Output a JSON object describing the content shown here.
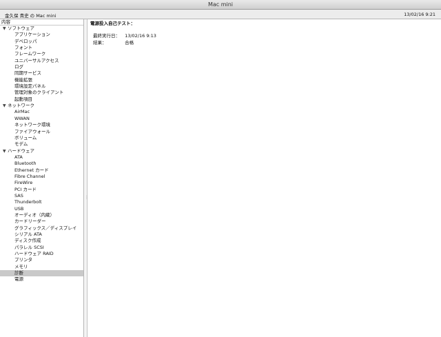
{
  "window": {
    "title": "Mac mini"
  },
  "header": {
    "machine": "金久保 貴史 の Mac mini",
    "date": "13/02/16 9:21"
  },
  "sidebar": {
    "header": "内容",
    "tree": [
      {
        "type": "cat",
        "label": "ソフトウェア"
      },
      {
        "type": "item",
        "label": "アプリケーション"
      },
      {
        "type": "item",
        "label": "デベロッパ"
      },
      {
        "type": "item",
        "label": "フォント"
      },
      {
        "type": "item",
        "label": "フレームワーク"
      },
      {
        "type": "item",
        "label": "ユニバーサルアクセス"
      },
      {
        "type": "item",
        "label": "ログ"
      },
      {
        "type": "item",
        "label": "同期サービス"
      },
      {
        "type": "item",
        "label": "機能拡張"
      },
      {
        "type": "item",
        "label": "環境設定パネル"
      },
      {
        "type": "item",
        "label": "管理対象のクライアント"
      },
      {
        "type": "item",
        "label": "起動項目"
      },
      {
        "type": "cat",
        "label": "ネットワーク"
      },
      {
        "type": "item",
        "label": "AirMac"
      },
      {
        "type": "item",
        "label": "WWAN"
      },
      {
        "type": "item",
        "label": "ネットワーク環境"
      },
      {
        "type": "item",
        "label": "ファイアウォール"
      },
      {
        "type": "item",
        "label": "ボリューム"
      },
      {
        "type": "item",
        "label": "モデム"
      },
      {
        "type": "cat",
        "label": "ハードウェア"
      },
      {
        "type": "item",
        "label": "ATA"
      },
      {
        "type": "item",
        "label": "Bluetooth"
      },
      {
        "type": "item",
        "label": "Ethernet カード"
      },
      {
        "type": "item",
        "label": "Fibre Channel"
      },
      {
        "type": "item",
        "label": "FireWire"
      },
      {
        "type": "item",
        "label": "PCI カード"
      },
      {
        "type": "item",
        "label": "SAS"
      },
      {
        "type": "item",
        "label": "Thunderbolt"
      },
      {
        "type": "item",
        "label": "USB"
      },
      {
        "type": "item",
        "label": "オーディオ（内蔵）"
      },
      {
        "type": "item",
        "label": "カードリーダー"
      },
      {
        "type": "item",
        "label": "グラフィックス／ディスプレイ"
      },
      {
        "type": "item",
        "label": "シリアル ATA"
      },
      {
        "type": "item",
        "label": "ディスク作成"
      },
      {
        "type": "item",
        "label": "パラレル SCSI"
      },
      {
        "type": "item",
        "label": "ハードウェア RAID"
      },
      {
        "type": "item",
        "label": "プリンタ"
      },
      {
        "type": "item",
        "label": "メモリ"
      },
      {
        "type": "item",
        "label": "診断",
        "selected": true
      },
      {
        "type": "item",
        "label": "電源"
      }
    ]
  },
  "main": {
    "heading": "電源投入自己テスト：",
    "fields": [
      {
        "label": "最終実行日：",
        "value": "13/02/16 9:13"
      },
      {
        "label": "結果：",
        "value": "合格"
      }
    ]
  }
}
